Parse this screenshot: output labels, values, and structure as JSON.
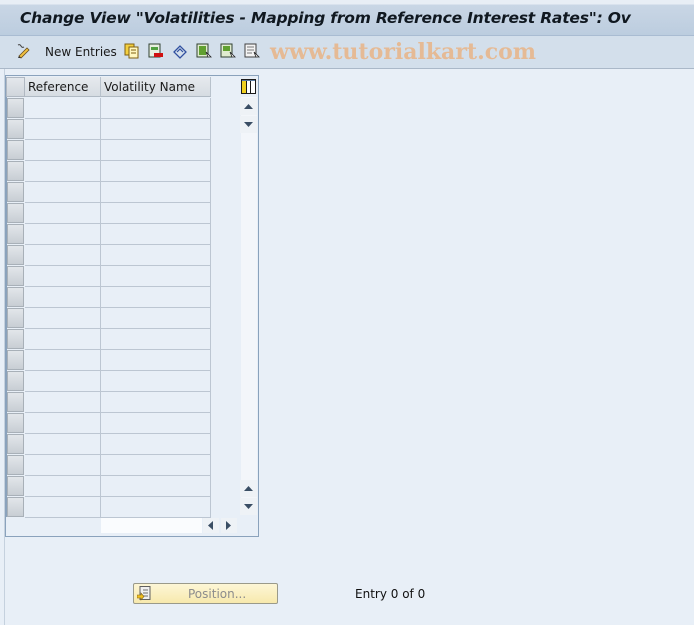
{
  "window": {
    "title": "Change View \"Volatilities - Mapping from Reference Interest Rates\": Ov"
  },
  "toolbar": {
    "items": [
      {
        "icon": "display-change-icon",
        "label": ""
      },
      {
        "icon": "new-entries",
        "label": "New Entries"
      },
      {
        "icon": "copy-as-icon",
        "label": ""
      },
      {
        "icon": "delete-icon",
        "label": ""
      },
      {
        "icon": "undo-change-icon",
        "label": ""
      },
      {
        "icon": "select-all-icon",
        "label": ""
      },
      {
        "icon": "select-block-icon",
        "label": ""
      },
      {
        "icon": "deselect-all-icon",
        "label": ""
      }
    ],
    "watermark": "www.tutorialkart.com"
  },
  "table": {
    "columns": [
      {
        "label": "Reference"
      },
      {
        "label": "Volatility Name"
      }
    ],
    "rows": [
      [
        "",
        ""
      ],
      [
        "",
        ""
      ],
      [
        "",
        ""
      ],
      [
        "",
        ""
      ],
      [
        "",
        ""
      ],
      [
        "",
        ""
      ],
      [
        "",
        ""
      ],
      [
        "",
        ""
      ],
      [
        "",
        ""
      ],
      [
        "",
        ""
      ],
      [
        "",
        ""
      ],
      [
        "",
        ""
      ],
      [
        "",
        ""
      ],
      [
        "",
        ""
      ],
      [
        "",
        ""
      ],
      [
        "",
        ""
      ],
      [
        "",
        ""
      ],
      [
        "",
        ""
      ],
      [
        "",
        ""
      ],
      [
        "",
        ""
      ]
    ]
  },
  "footer": {
    "position_button": "Position...",
    "entry_status": "Entry 0 of 0"
  }
}
